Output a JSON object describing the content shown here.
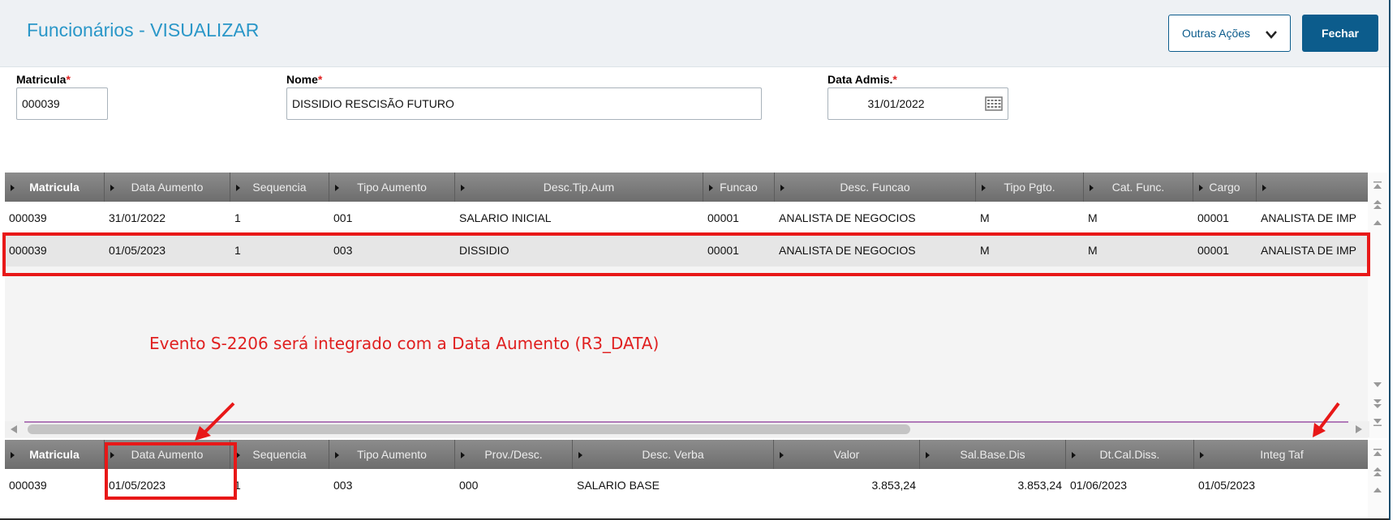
{
  "header": {
    "title": "Funcionários - VISUALIZAR",
    "outras_acoes_label": "Outras Ações",
    "fechar_label": "Fechar"
  },
  "form": {
    "matricula": {
      "label": "Matricula",
      "required_mark": "*",
      "value": "000039"
    },
    "nome": {
      "label": "Nome",
      "required_mark": "*",
      "value": "DISSIDIO RESCISÃO FUTURO"
    },
    "data_admis": {
      "label": "Data Admis.",
      "required_mark": "*",
      "value": "31/01/2022"
    }
  },
  "grid1": {
    "columns": [
      "Matricula",
      "Data Aumento",
      "Sequencia",
      "Tipo Aumento",
      "Desc.Tip.Aum",
      "Funcao",
      "Desc. Funcao",
      "Tipo Pgto.",
      "Cat. Func.",
      "Cargo",
      ""
    ],
    "rows": [
      [
        "000039",
        "31/01/2022",
        "1",
        "001",
        "SALARIO INICIAL",
        "00001",
        "ANALISTA DE NEGOCIOS",
        "M",
        "M",
        "00001",
        "ANALISTA DE IMP"
      ],
      [
        "000039",
        "01/05/2023",
        "1",
        "003",
        "DISSIDIO",
        "00001",
        "ANALISTA DE NEGOCIOS",
        "M",
        "M",
        "00001",
        "ANALISTA DE IMP"
      ]
    ]
  },
  "annotation": "Evento S-2206 será integrado com a Data Aumento (R3_DATA)",
  "grid2": {
    "columns": [
      "Matricula",
      "Data Aumento",
      "Sequencia",
      "Tipo Aumento",
      "Prov./Desc.",
      "Desc. Verba",
      "Valor",
      "Sal.Base.Dis",
      "Dt.Cal.Diss.",
      "Integ Taf"
    ],
    "rows": [
      [
        "000039",
        "01/05/2023",
        "1",
        "003",
        "000",
        "SALARIO BASE",
        "3.853,24",
        "3.853,24",
        "01/06/2023",
        "01/05/2023"
      ]
    ]
  },
  "colors": {
    "accent": "#0c5c8c",
    "title": "#2a97c8",
    "highlight": "#e81818",
    "grid_header": "#7c7c7c"
  }
}
